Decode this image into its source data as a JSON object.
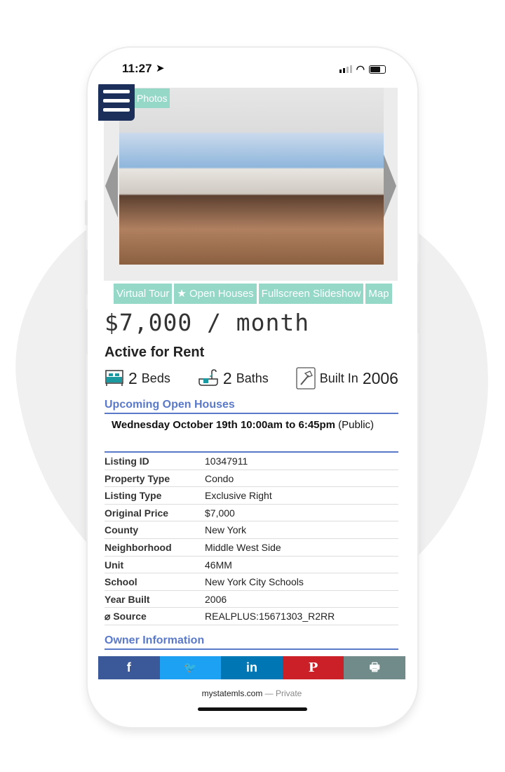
{
  "status_bar": {
    "time": "11:27"
  },
  "gallery": {
    "photos_label": "Photos"
  },
  "actions": [
    "Virtual Tour",
    "★ Open Houses",
    "Fullscreen Slideshow",
    "Map"
  ],
  "listing": {
    "price": "$7,000 / month",
    "status": "Active for Rent",
    "beds_num": "2",
    "beds_label": "Beds",
    "baths_num": "2",
    "baths_label": "Baths",
    "built_label": "Built In",
    "built_year": "2006"
  },
  "open_houses": {
    "heading": "Upcoming Open Houses",
    "entry_bold": "Wednesday October 19th 10:00am to 6:45pm",
    "entry_type": "(Public)"
  },
  "details": [
    {
      "k": "Listing ID",
      "v": "10347911"
    },
    {
      "k": "Property Type",
      "v": "Condo"
    },
    {
      "k": "Listing Type",
      "v": "Exclusive Right"
    },
    {
      "k": "Original Price",
      "v": "$7,000"
    },
    {
      "k": "County",
      "v": "New York"
    },
    {
      "k": "Neighborhood",
      "v": "Middle West Side"
    },
    {
      "k": "Unit",
      "v": "46MM"
    },
    {
      "k": "School",
      "v": "New York City Schools"
    },
    {
      "k": "Year Built",
      "v": "2006"
    },
    {
      "k": "⌀ Source",
      "v": "REALPLUS:15671303_R2RR"
    }
  ],
  "owner": {
    "heading": "Owner Information"
  },
  "share": {
    "facebook": "f",
    "twitter": "🐦",
    "linkedin": "in",
    "pinterest": "P",
    "print": "🖶",
    "colors": {
      "facebook": "#3b5998",
      "twitter": "#1da1f2",
      "linkedin": "#0077b5",
      "pinterest": "#cb2027",
      "print": "#718a8a"
    }
  },
  "browser": {
    "domain": "mystatemls.com",
    "suffix": " — Private"
  }
}
